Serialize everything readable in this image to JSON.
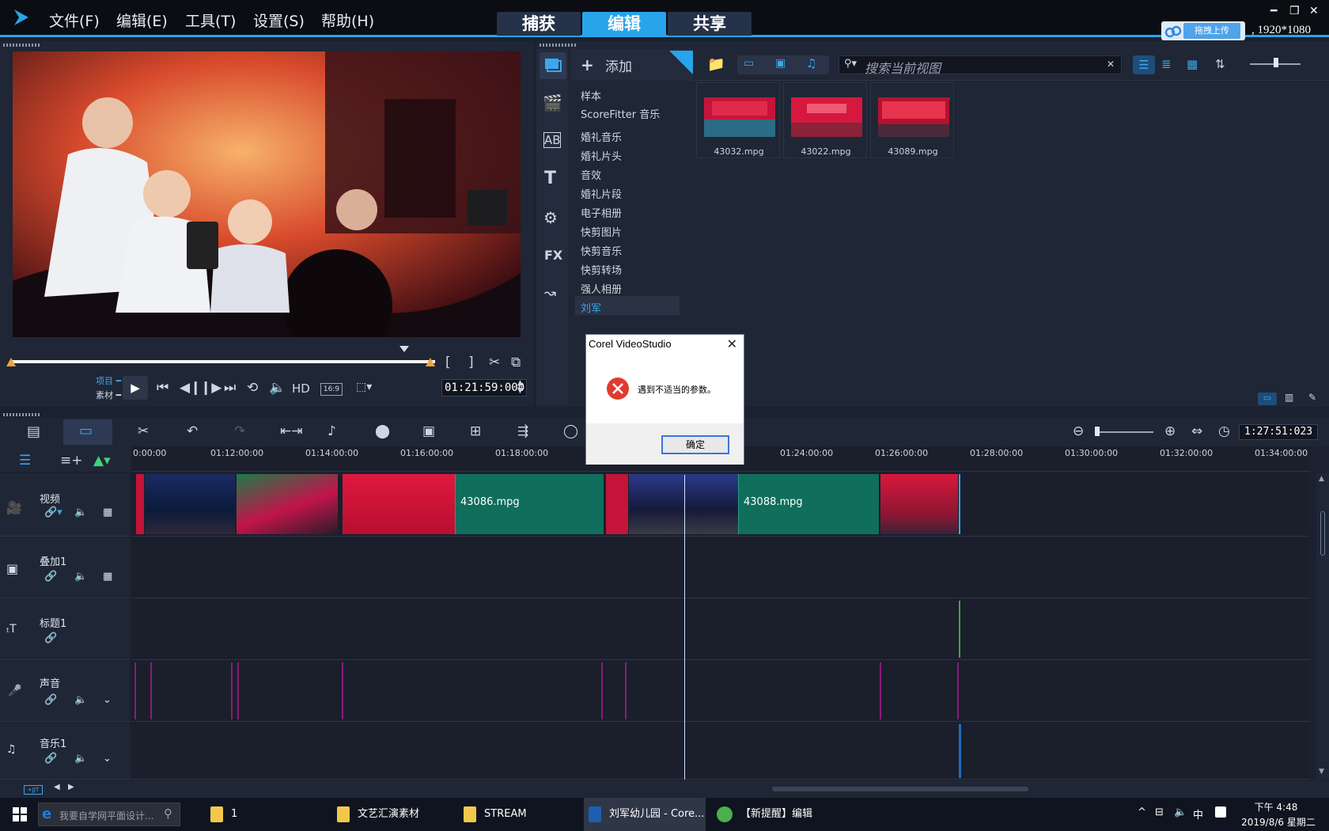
{
  "menu": {
    "file": "文件(F)",
    "edit": "编辑(E)",
    "tools": "工具(T)",
    "settings": "设置(S)",
    "help": "帮助(H)"
  },
  "modes": {
    "capture": "捕获",
    "edit": "编辑",
    "share": "共享"
  },
  "upload": {
    "label": "拖拽上传",
    "resolution": "1920*1080"
  },
  "player": {
    "project_label": "项目",
    "clip_label": "素材",
    "hd": "HD",
    "aspect": "16:9",
    "timecode": "01:21:59:000"
  },
  "library": {
    "add_label": "添加",
    "items": [
      "样本",
      "ScoreFitter 音乐",
      "婚礼音乐",
      "婚礼片头",
      "音效",
      "婚礼片段",
      "电子相册",
      "快剪图片",
      "快剪音乐",
      "快剪转场",
      "强人相册",
      "刘军"
    ],
    "search_placeholder": "搜索当前视图",
    "thumbnails": [
      {
        "name": "43032.mpg"
      },
      {
        "name": "43022.mpg"
      },
      {
        "name": "43089.mpg"
      }
    ]
  },
  "timeline": {
    "zoom_timecode": "1:27:51:023",
    "ruler": [
      "0:00:00",
      "01:12:00:00",
      "01:14:00:00",
      "01:16:00:00",
      "01:18:00:00",
      "01:24:00:00",
      "01:26:00:00",
      "01:28:00:00",
      "01:30:00:00",
      "01:32:00:00",
      "01:34:00:00"
    ],
    "tracks": [
      {
        "name": "视频"
      },
      {
        "name": "叠加1"
      },
      {
        "name": "标题1"
      },
      {
        "name": "声音"
      },
      {
        "name": "音乐1"
      }
    ],
    "clips": [
      {
        "name": "43086.mpg"
      },
      {
        "name": "43088.mpg"
      }
    ],
    "bottom_btn": "+JJT"
  },
  "dialog": {
    "title": "Corel VideoStudio",
    "message": "遇到不适当的参数。",
    "ok": "确定"
  },
  "taskbar": {
    "search_placeholder": "我要自学网平面设计...",
    "items": [
      "1",
      "文艺汇演素材",
      "STREAM",
      "刘军幼儿园 - Core...",
      "【新提醒】编辑帖..."
    ],
    "ime": "中",
    "time": "下午 4:48",
    "date": "2019/8/6 星期二"
  },
  "colors": {
    "accent": "#27a4ea",
    "clip_green": "#0f6e5c",
    "dialog_error": "#e03b30"
  }
}
